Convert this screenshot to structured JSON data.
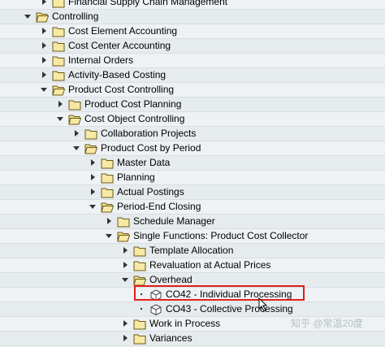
{
  "tree": {
    "rows": [
      {
        "level": 1,
        "state": "collapsed",
        "icon": "folder-closed-icon",
        "label": "Financial Supply Chain Management"
      },
      {
        "level": 0,
        "state": "expanded",
        "icon": "folder-open-icon",
        "label": "Controlling"
      },
      {
        "level": 1,
        "state": "collapsed",
        "icon": "folder-closed-icon",
        "label": "Cost Element Accounting"
      },
      {
        "level": 1,
        "state": "collapsed",
        "icon": "folder-closed-icon",
        "label": "Cost Center Accounting"
      },
      {
        "level": 1,
        "state": "collapsed",
        "icon": "folder-closed-icon",
        "label": "Internal Orders"
      },
      {
        "level": 1,
        "state": "collapsed",
        "icon": "folder-closed-icon",
        "label": "Activity-Based Costing"
      },
      {
        "level": 1,
        "state": "expanded",
        "icon": "folder-open-icon",
        "label": "Product Cost Controlling"
      },
      {
        "level": 2,
        "state": "collapsed",
        "icon": "folder-closed-icon",
        "label": "Product Cost Planning"
      },
      {
        "level": 2,
        "state": "expanded",
        "icon": "folder-open-icon",
        "label": "Cost Object Controlling"
      },
      {
        "level": 3,
        "state": "collapsed",
        "icon": "folder-closed-icon",
        "label": "Collaboration Projects"
      },
      {
        "level": 3,
        "state": "expanded",
        "icon": "folder-open-icon",
        "label": "Product Cost by Period"
      },
      {
        "level": 4,
        "state": "collapsed",
        "icon": "folder-closed-icon",
        "label": "Master Data"
      },
      {
        "level": 4,
        "state": "collapsed",
        "icon": "folder-closed-icon",
        "label": "Planning"
      },
      {
        "level": 4,
        "state": "collapsed",
        "icon": "folder-closed-icon",
        "label": "Actual Postings"
      },
      {
        "level": 4,
        "state": "expanded",
        "icon": "folder-open-icon",
        "label": "Period-End Closing"
      },
      {
        "level": 5,
        "state": "collapsed",
        "icon": "folder-closed-icon",
        "label": "Schedule Manager"
      },
      {
        "level": 5,
        "state": "expanded",
        "icon": "folder-open-icon",
        "label": "Single Functions: Product Cost Collector"
      },
      {
        "level": 6,
        "state": "collapsed",
        "icon": "folder-closed-icon",
        "label": "Template Allocation"
      },
      {
        "level": 6,
        "state": "collapsed",
        "icon": "folder-closed-icon",
        "label": "Revaluation at Actual Prices"
      },
      {
        "level": 6,
        "state": "expanded",
        "icon": "folder-open-icon",
        "label": "Overhead"
      },
      {
        "level": 7,
        "state": "leaf",
        "icon": "transaction-cube-icon",
        "label": "CO42 - Individual Processing",
        "highlighted": true
      },
      {
        "level": 7,
        "state": "leaf",
        "icon": "transaction-cube-icon",
        "label": "CO43 - Collective Processing"
      },
      {
        "level": 6,
        "state": "collapsed",
        "icon": "folder-closed-icon",
        "label": "Work in Process"
      },
      {
        "level": 6,
        "state": "collapsed",
        "icon": "folder-closed-icon",
        "label": "Variances"
      }
    ]
  },
  "watermark": "知乎 @常温20度",
  "colors": {
    "highlight": "#e0201c",
    "folder_fill": "#f7e8a4",
    "folder_stroke": "#6b5a1e"
  }
}
